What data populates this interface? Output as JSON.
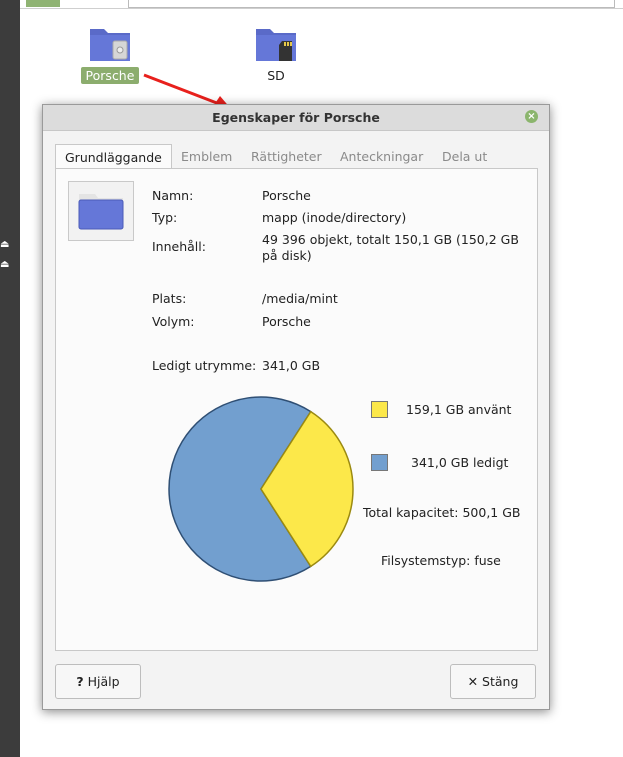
{
  "desktop": {
    "icons": [
      {
        "label": "Porsche",
        "selected": true
      },
      {
        "label": "SD",
        "selected": false
      }
    ]
  },
  "dialog": {
    "title": "Egenskaper för Porsche",
    "tabs": [
      "Grundläggande",
      "Emblem",
      "Rättigheter",
      "Anteckningar",
      "Dela ut"
    ],
    "active_tab": "Grundläggande",
    "fields": {
      "name_label": "Namn:",
      "name_value": "Porsche",
      "type_label": "Typ:",
      "type_value": "mapp (inode/directory)",
      "contents_label": "Innehåll:",
      "contents_value": "49 396 objekt, totalt 150,1 GB (150,2 GB på disk)",
      "location_label": "Plats:",
      "location_value": "/media/mint",
      "volume_label": "Volym:",
      "volume_value": "Porsche",
      "free_label": "Ledigt utrymme:",
      "free_value": "341,0 GB"
    },
    "usage": {
      "used_label": "159,1 GB använt",
      "free_label": "341,0 GB ledigt",
      "total_label": "Total kapacitet: 500,1 GB",
      "fs_label": "Filsystemstyp: fuse",
      "used_color": "#fce84a",
      "free_color": "#729fcf"
    },
    "buttons": {
      "help_icon": "?",
      "help_label": "Hjälp",
      "close_icon": "✕",
      "close_label": "Stäng"
    }
  }
}
